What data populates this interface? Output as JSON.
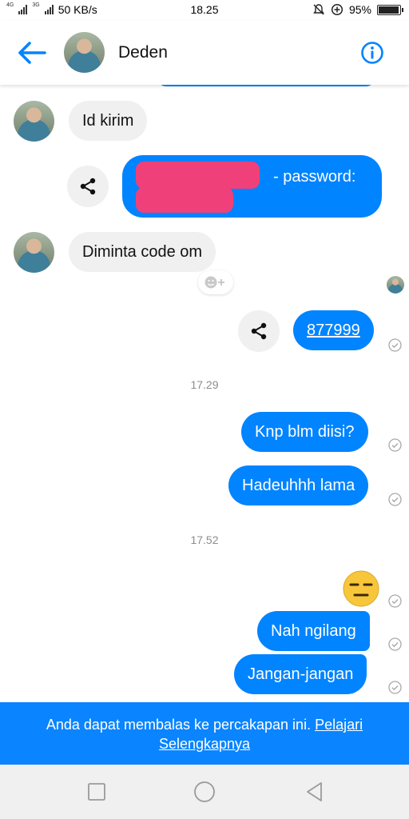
{
  "status_bar": {
    "network_left": "4G",
    "network_right": "3G",
    "speed": "50 KB/s",
    "time": "18.25",
    "battery": "95%"
  },
  "header": {
    "contact_name": "Deden"
  },
  "messages": {
    "m1_text": "Id kirim",
    "m2_suffix": "- password:",
    "m3_text": "Diminta code om",
    "m4_text": "877999",
    "time1": "17.29",
    "m5_text": "Knp blm diisi?",
    "m6_text": "Hadeuhhh lama",
    "time2": "17.52",
    "m7_emoji": "😑",
    "m8_text": "Nah ngilang",
    "m9_text": "Jangan-jangan"
  },
  "notice": {
    "text": "Anda dapat membalas ke percakapan ini.",
    "link": "Pelajari Selengkapnya"
  },
  "colors": {
    "accent": "#0084ff",
    "notice_bg": "#0a84ff",
    "incoming_bubble": "#f1f0f0",
    "redaction": "#f0407a"
  }
}
